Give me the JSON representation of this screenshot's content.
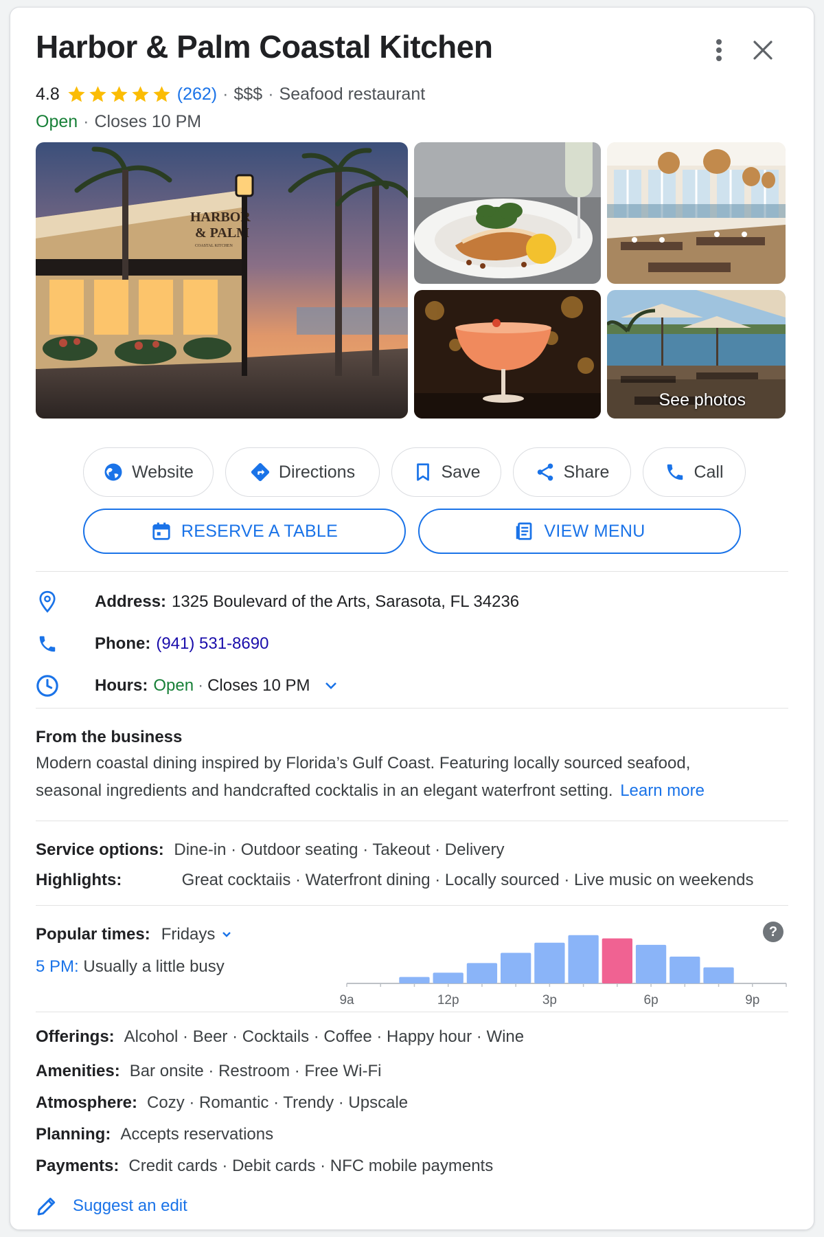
{
  "header": {
    "title": "Harbor & Palm Coastal Kitchen",
    "rating": "4.8",
    "stars": 5,
    "review_count": "(262)",
    "price": "$$$",
    "category": "Seafood restaurant",
    "status": "Open",
    "closes": "Closes 10 PM"
  },
  "photos": {
    "see_photos_label": "See photos",
    "sign_line1": "HARBOR",
    "sign_line2": "& PALM",
    "sign_line3": "COASTAL KITCHEN"
  },
  "actions": {
    "website": "Website",
    "directions": "Directions",
    "save": "Save",
    "share": "Share",
    "call": "Call",
    "reserve": "RESERVE A TABLE",
    "menu": "VIEW MENU"
  },
  "details": {
    "address_label": "Address:",
    "address": "1325 Boulevard of the Arts, Sarasota, FL 34236",
    "phone_label": "Phone:",
    "phone": "(941) 531-8690",
    "hours_label": "Hours:",
    "hours_status": "Open",
    "hours_closes": "Closes 10 PM"
  },
  "business": {
    "title": "From the business",
    "description": "Modern coastal dining inspired by Florida’s Gulf Coast. Featuring locally sourced seafood, seasonal ingredients and handcrafted cocktalis in an elegant waterfront setting.",
    "learn_more": "Learn more"
  },
  "service": {
    "label": "Service options:",
    "value": "Dine-in · Outdoor seating · Takeout · Delivery"
  },
  "highlights": {
    "label": "Highlights:",
    "value": "Great cocktaiis · Waterfront dining · Locally sourced · Live music on weekends"
  },
  "popular_times": {
    "label": "Popular times:",
    "day": "Fridays",
    "time": "5 PM:",
    "status": "Usually a little busy"
  },
  "chart_data": {
    "type": "bar",
    "x_ticks": [
      "9a",
      "12p",
      "3p",
      "6p",
      "9p"
    ],
    "x": [
      11,
      12,
      13,
      14,
      15,
      16,
      17,
      18,
      19,
      20
    ],
    "values": [
      12,
      20,
      38,
      57,
      76,
      90,
      84,
      72,
      50,
      30
    ],
    "values_aligned_note_free": true,
    "highlight_x": 17,
    "xlim": [
      9,
      22
    ],
    "ylim": [
      0,
      100
    ],
    "colors": {
      "bar": "#8ab4f8",
      "highlight": "#f06292"
    }
  },
  "attributes": [
    {
      "label": "Offerings:",
      "value": "Alcohol · Beer · Cocktails · Coffee · Happy hour · Wine"
    },
    {
      "label": "Amenities:",
      "value": "Bar onsite · Restroom · Free Wi-Fi"
    },
    {
      "label": "Atmosphere:",
      "value": "Cozy · Romantic · Trendy · Upscale"
    },
    {
      "label": "Planning:",
      "value": "Accepts reservations"
    },
    {
      "label": "Payments:",
      "value": "Credit cards · Debit cards · NFC mobile payments"
    }
  ],
  "suggest_edit": "Suggest an edit",
  "colors": {
    "accent": "#1a73e8",
    "link": "#1a0dab",
    "open": "#188038",
    "star": "#fbbc04"
  }
}
